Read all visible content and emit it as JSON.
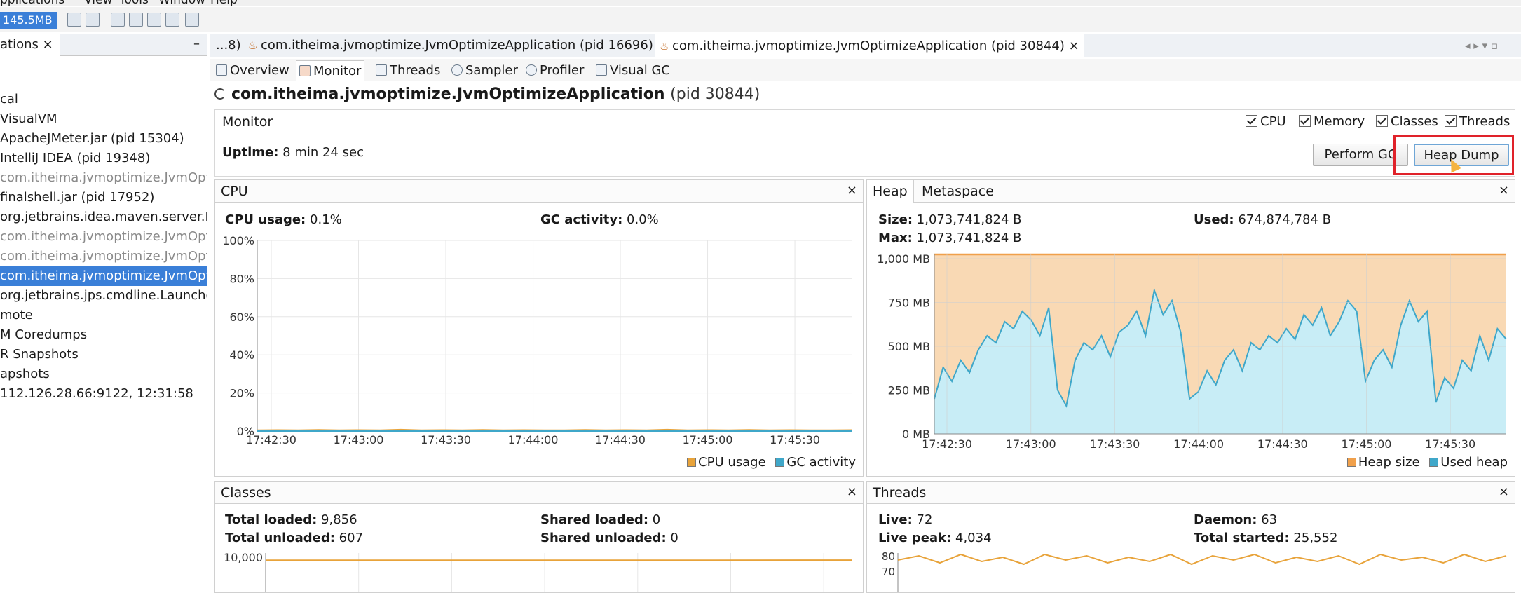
{
  "menu": [
    "pplications",
    "View",
    "Tools",
    "Window",
    "Help"
  ],
  "toolbar": {
    "memory": "145.5MB"
  },
  "left_panel": {
    "tab_label": "ations ×",
    "minimize": "–",
    "items": [
      {
        "label": "cal",
        "indent": 0,
        "state": "normal"
      },
      {
        "label": "VisualVM",
        "indent": 0,
        "state": "normal"
      },
      {
        "label": "ApacheJMeter.jar (pid 15304)",
        "indent": 0,
        "state": "normal"
      },
      {
        "label": "IntelliJ IDEA (pid 19348)",
        "indent": 0,
        "state": "normal"
      },
      {
        "label": "com.itheima.jvmoptimize.JvmOpti",
        "indent": 0,
        "state": "dim"
      },
      {
        "label": "finalshell.jar (pid 17952)",
        "indent": 0,
        "state": "normal"
      },
      {
        "label": "org.jetbrains.idea.maven.server.Re",
        "indent": 0,
        "state": "normal"
      },
      {
        "label": "com.itheima.jvmoptimize.JvmOpti",
        "indent": 0,
        "state": "dim"
      },
      {
        "label": "com.itheima.jvmoptimize.JvmOpti",
        "indent": 0,
        "state": "dim"
      },
      {
        "label": "com.itheima.jvmoptimize.JvmOpti",
        "indent": 0,
        "state": "sel"
      },
      {
        "label": "org.jetbrains.jps.cmdline.Launcher",
        "indent": 0,
        "state": "normal"
      },
      {
        "label": "mote",
        "indent": 0,
        "state": "normal"
      },
      {
        "label": "M Coredumps",
        "indent": 0,
        "state": "normal"
      },
      {
        "label": "R Snapshots",
        "indent": 0,
        "state": "normal"
      },
      {
        "label": "apshots",
        "indent": 0,
        "state": "normal"
      },
      {
        "label": "112.126.28.66:9122, 12:31:58",
        "indent": 0,
        "state": "normal"
      }
    ]
  },
  "editor_tabs": {
    "tab1": "...8)",
    "tab2": "com.itheima.jvmoptimize.JvmOptimizeApplication (pid 16696)",
    "tab3": "com.itheima.jvmoptimize.JvmOptimizeApplication (pid 30844)",
    "close": "×",
    "nav": "◂ ▸ ▾ ▫"
  },
  "subtabs": [
    "Overview",
    "Monitor",
    "Threads",
    "Sampler",
    "Profiler",
    "Visual GC"
  ],
  "process": {
    "name": "com.itheima.jvmoptimize.JvmOptimizeApplication",
    "pid": "(pid 30844)"
  },
  "monitor": {
    "label": "Monitor",
    "uptime_label": "Uptime:",
    "uptime_value": "8 min 24 sec",
    "checkboxes": [
      "CPU",
      "Memory",
      "Classes",
      "Threads"
    ],
    "perform_gc": "Perform GC",
    "heap_dump": "Heap Dump"
  },
  "cpu_panel": {
    "title": "CPU",
    "close": "×",
    "cpu_usage_label": "CPU usage:",
    "cpu_usage_value": "0.1%",
    "gc_label": "GC activity:",
    "gc_value": "0.0%",
    "legend": [
      "CPU usage",
      "GC activity"
    ]
  },
  "heap_panel": {
    "tabs": [
      "Heap",
      "Metaspace"
    ],
    "close": "×",
    "size_label": "Size:",
    "size_value": "1,073,741,824 B",
    "used_label": "Used:",
    "used_value": "674,874,784 B",
    "max_label": "Max:",
    "max_value": "1,073,741,824 B",
    "legend": [
      "Heap size",
      "Used heap"
    ]
  },
  "classes_panel": {
    "title": "Classes",
    "close": "×",
    "total_loaded_label": "Total loaded:",
    "total_loaded_value": "9,856",
    "shared_loaded_label": "Shared loaded:",
    "shared_loaded_value": "0",
    "total_unloaded_label": "Total unloaded:",
    "total_unloaded_value": "607",
    "shared_unloaded_label": "Shared unloaded:",
    "shared_unloaded_value": "0"
  },
  "threads_panel": {
    "title": "Threads",
    "close": "×",
    "live_label": "Live:",
    "live_value": "72",
    "daemon_label": "Daemon:",
    "daemon_value": "63",
    "live_peak_label": "Live peak:",
    "live_peak_value": "4,034",
    "total_started_label": "Total started:",
    "total_started_value": "25,552"
  },
  "colors": {
    "selection": "#3a7fd8",
    "heap_size": "#f0a04b",
    "used_heap": "#3fa7c9",
    "cpu_usage": "#e8a33a",
    "highlight": "#e0222a"
  },
  "chart_data": [
    {
      "type": "line",
      "name": "cpu",
      "x": [
        "17:42:30",
        "17:43:00",
        "17:43:30",
        "17:44:00",
        "17:44:30",
        "17:45:00",
        "17:45:30"
      ],
      "ytick_labels": [
        "0%",
        "20%",
        "40%",
        "60%",
        "80%",
        "100%"
      ],
      "ylim": [
        0,
        100
      ],
      "series": [
        {
          "name": "CPU usage",
          "values": [
            0.1,
            0.2,
            0.1,
            0.3,
            0.1,
            0.2,
            0.1,
            0.4,
            0.1,
            0.2,
            0.1,
            0.3,
            0.1,
            0.2,
            0.1,
            0.1,
            0.3,
            0.1,
            0.2,
            0.1,
            0.4,
            0.1,
            0.2,
            0.1,
            0.3,
            0.1,
            0.2,
            0.1,
            0.1,
            0.2
          ]
        },
        {
          "name": "GC activity",
          "values": [
            0,
            0,
            0,
            0,
            0,
            0,
            0,
            0,
            0,
            0,
            0,
            0,
            0,
            0,
            0,
            0,
            0,
            0,
            0,
            0,
            0,
            0,
            0,
            0,
            0,
            0,
            0,
            0,
            0,
            0
          ]
        }
      ]
    },
    {
      "type": "area",
      "name": "heap",
      "x": [
        "17:42:30",
        "17:43:00",
        "17:43:30",
        "17:44:00",
        "17:44:30",
        "17:45:00",
        "17:45:30"
      ],
      "ytick_labels": [
        "0 MB",
        "250 MB",
        "500 MB",
        "750 MB",
        "1,000 MB"
      ],
      "ylim": [
        0,
        1024
      ],
      "series": [
        {
          "name": "Heap size",
          "values": [
            1024,
            1024
          ]
        },
        {
          "name": "Used heap",
          "values": [
            200,
            380,
            300,
            420,
            350,
            480,
            560,
            520,
            640,
            600,
            700,
            650,
            560,
            720,
            250,
            160,
            420,
            520,
            480,
            560,
            440,
            580,
            620,
            700,
            560,
            820,
            680,
            760,
            580,
            200,
            240,
            360,
            280,
            420,
            480,
            360,
            520,
            480,
            560,
            520,
            600,
            540,
            680,
            620,
            720,
            560,
            640,
            760,
            700,
            300,
            420,
            480,
            380,
            620,
            760,
            640,
            700,
            180,
            320,
            260,
            420,
            360,
            560,
            420,
            600,
            540
          ]
        }
      ]
    },
    {
      "type": "line",
      "name": "classes",
      "ytick_labels": [
        "10,000"
      ],
      "ylim": [
        0,
        10000
      ],
      "series": [
        {
          "name": "Classes",
          "values": [
            9850,
            9850,
            9856
          ]
        }
      ]
    },
    {
      "type": "line",
      "name": "threads",
      "ytick_labels": [
        "80",
        "70"
      ],
      "ylim": [
        60,
        80
      ],
      "series": [
        {
          "name": "Threads",
          "values": [
            76,
            79,
            74,
            80,
            75,
            78,
            73,
            80,
            76,
            79,
            74,
            78,
            75,
            80,
            73,
            79,
            76,
            80,
            74,
            78,
            75,
            79,
            73,
            80,
            76,
            78,
            74,
            80,
            75,
            79
          ]
        }
      ]
    }
  ]
}
